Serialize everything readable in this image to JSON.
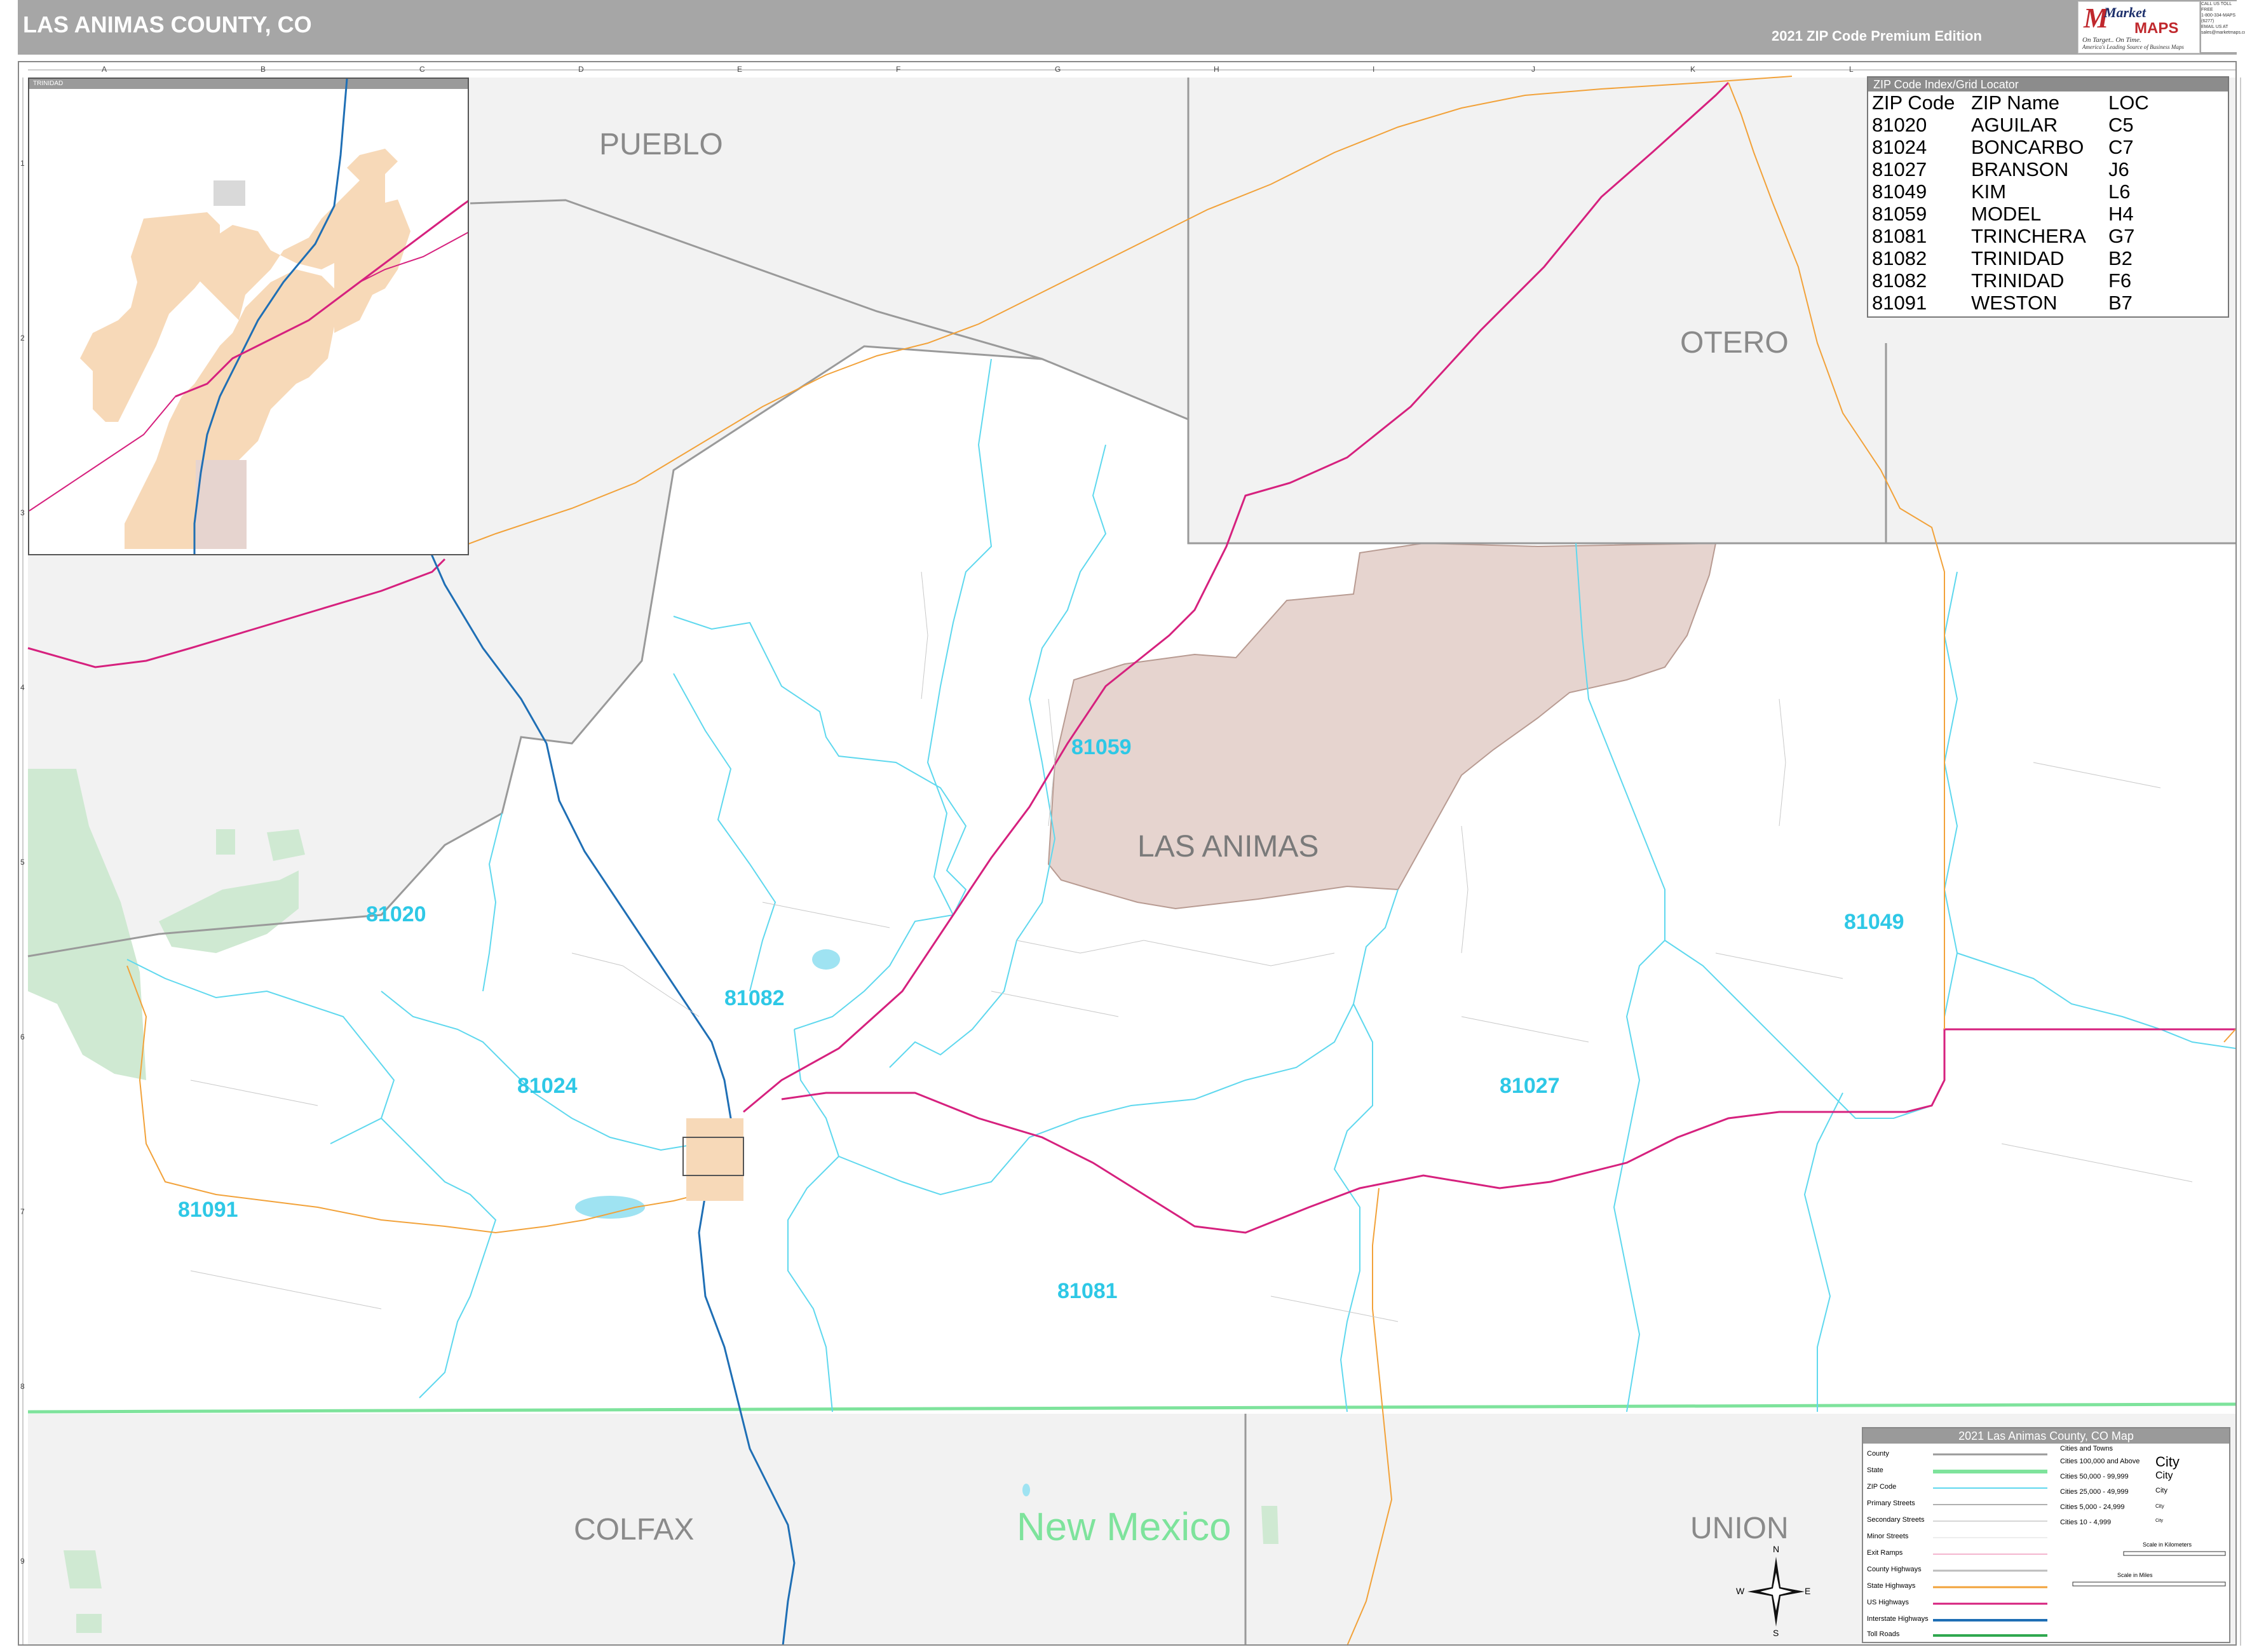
{
  "header": {
    "title": "LAS ANIMAS COUNTY, CO",
    "edition": "2021 ZIP Code Premium Edition",
    "logo_market": "Market",
    "logo_maps": "MAPS",
    "logo_tagline": "On Target.. On Time.",
    "logo_tagline2": "America's Leading Source of Business Maps",
    "contact_lines": [
      "CALL US TOLL FREE",
      "1-800-334-MAPS (6277)",
      "",
      "EMAIL US AT",
      "sales@marketmaps.com"
    ]
  },
  "grid": {
    "columns": [
      "A",
      "B",
      "C",
      "D",
      "E",
      "F",
      "G",
      "H",
      "I",
      "J",
      "K",
      "L"
    ],
    "rows": [
      "1",
      "2",
      "3",
      "4",
      "5",
      "6",
      "7",
      "8",
      "9"
    ]
  },
  "counties": {
    "pueblo": "PUEBLO",
    "otero": "OTERO",
    "las_animas": "LAS ANIMAS",
    "colfax": "COLFAX",
    "union": "UNION"
  },
  "state_label": "New Mexico",
  "zip_labels": [
    "81059",
    "81020",
    "81082",
    "81024",
    "81091",
    "81081",
    "81027",
    "81049"
  ],
  "zip_index": {
    "title": "ZIP Code Index/Grid Locator",
    "headers": [
      "ZIP Code",
      "ZIP Name",
      "LOC"
    ],
    "rows": [
      [
        "81020",
        "AGUILAR",
        "C5"
      ],
      [
        "81024",
        "BONCARBO",
        "C7"
      ],
      [
        "81027",
        "BRANSON",
        "J6"
      ],
      [
        "81049",
        "KIM",
        "L6"
      ],
      [
        "81059",
        "MODEL",
        "H4"
      ],
      [
        "81081",
        "TRINCHERA",
        "G7"
      ],
      [
        "81082",
        "TRINIDAD",
        "B2"
      ],
      [
        "81082",
        "TRINIDAD",
        "F6"
      ],
      [
        "81091",
        "WESTON",
        "B7"
      ]
    ]
  },
  "inset": {
    "title": "TRINIDAD"
  },
  "legend": {
    "title": "2021 Las Animas County, CO Map",
    "items": [
      "County",
      "State",
      "ZIP Code",
      "Primary Streets",
      "Secondary Streets",
      "Minor Streets",
      "Exit Ramps",
      "County Highways",
      "State Highways",
      "US Highways",
      "Interstate Highways",
      "Toll Roads"
    ],
    "cities_title": "Cities and Towns",
    "cities": [
      [
        "Cities 100,000 and Above",
        "City"
      ],
      [
        "Cities 50,000 - 99,999",
        "City"
      ],
      [
        "Cities 25,000 - 49,999",
        "City"
      ],
      [
        "Cities 5,000 - 24,999",
        "City"
      ],
      [
        "Cities 10 - 4,999",
        "City"
      ]
    ],
    "scale_km": "Scale in Kilometers",
    "scale_mi": "Scale in Miles"
  },
  "compass": {
    "n": "N",
    "s": "S",
    "e": "E",
    "w": "W"
  },
  "colors": {
    "zip_boundary": "#5fd8ee",
    "state_line": "#7ee39c",
    "us_highway": "#d6217e",
    "interstate": "#1f6fb5",
    "state_highway": "#f2a23a",
    "outside_county": "#f2f2f2",
    "reservation": "#e6d4cf",
    "forest": "#cfe9d2",
    "water": "#9fe3f2"
  }
}
